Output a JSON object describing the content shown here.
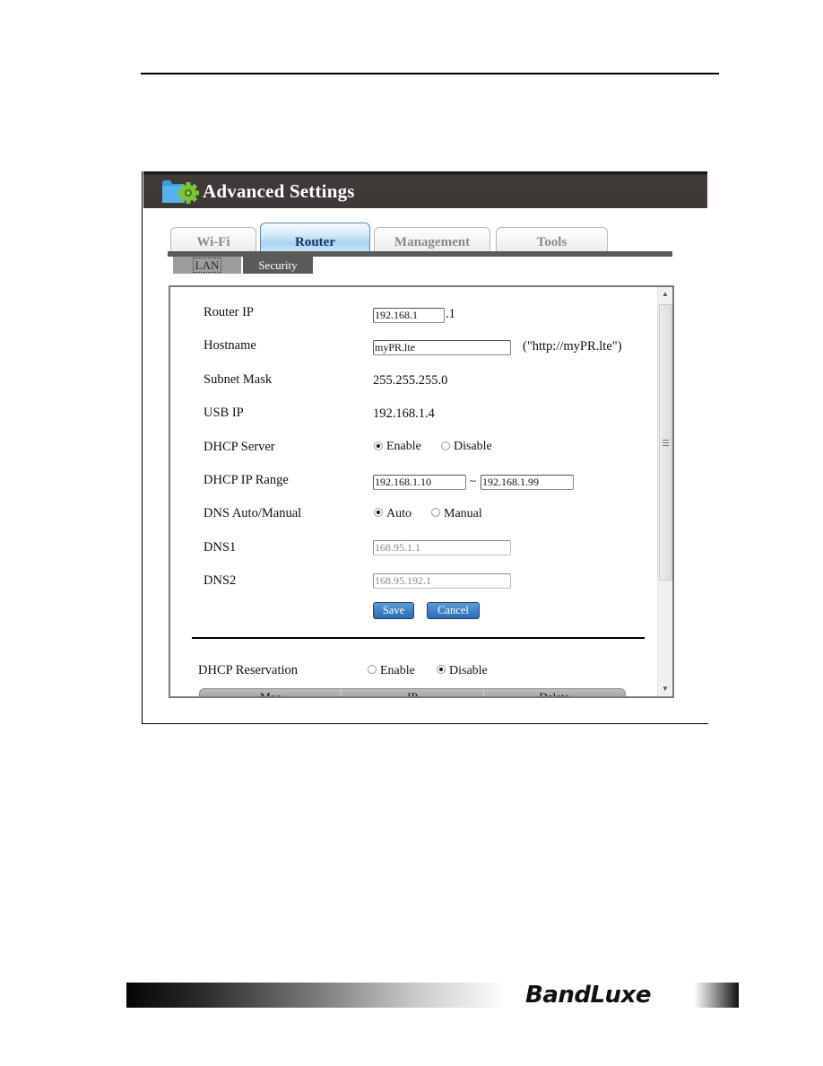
{
  "window": {
    "title": "Advanced Settings",
    "icon": "folder-gear-icon",
    "header_color": "#3e3836"
  },
  "tabs": [
    {
      "label": "Wi-Fi",
      "active": false
    },
    {
      "label": "Router",
      "active": true
    },
    {
      "label": "Management",
      "active": false
    },
    {
      "label": "Tools",
      "active": false
    }
  ],
  "subtabs": [
    {
      "label": "LAN",
      "active": true
    },
    {
      "label": "Security",
      "active": false
    }
  ],
  "lan": {
    "router_ip": {
      "label": "Router IP",
      "value": "192.168.1",
      "suffix": ".1"
    },
    "hostname": {
      "label": "Hostname",
      "value": "myPR.lte",
      "hint": "(\"http://myPR.lte\")"
    },
    "subnet_mask": {
      "label": "Subnet Mask",
      "value": "255.255.255.0"
    },
    "usb_ip": {
      "label": "USB IP",
      "value": "192.168.1.4"
    },
    "dhcp_server": {
      "label": "DHCP Server",
      "options": [
        "Enable",
        "Disable"
      ],
      "selected": "Enable"
    },
    "dhcp_range": {
      "label": "DHCP IP Range",
      "start": "192.168.1.10",
      "separator": "~",
      "end": "192.168.1.99"
    },
    "dns_mode": {
      "label": "DNS Auto/Manual",
      "options": [
        "Auto",
        "Manual"
      ],
      "selected": "Auto"
    },
    "dns1": {
      "label": "DNS1",
      "value": "168.95.1.1"
    },
    "dns2": {
      "label": "DNS2",
      "value": "168.95.192.1"
    },
    "save_label": "Save",
    "cancel_label": "Cancel",
    "button_color": "#2f72b8"
  },
  "reservation": {
    "label": "DHCP Reservation",
    "options": [
      "Enable",
      "Disable"
    ],
    "selected": "Disable",
    "columns": [
      "Mac",
      "IP",
      "Delete"
    ]
  },
  "footer": {
    "brand": "BandLuxe"
  }
}
